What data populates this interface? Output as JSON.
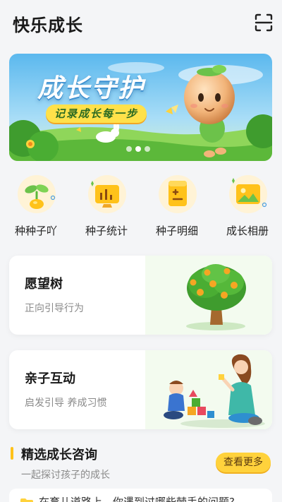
{
  "header": {
    "title": "快乐成长",
    "scan_icon": "scan-icon"
  },
  "banner": {
    "title": "成长守护",
    "subtitle": "记录成长每一步",
    "slide_count": 3,
    "active_slide": 1
  },
  "quick_actions": [
    {
      "label": "种种子吖",
      "icon": "sprout-icon"
    },
    {
      "label": "种子统计",
      "icon": "stats-icon"
    },
    {
      "label": "种子明细",
      "icon": "detail-list-icon"
    },
    {
      "label": "成长相册",
      "icon": "photo-album-icon"
    }
  ],
  "cards": {
    "wish_tree": {
      "title": "愿望树",
      "subtitle": "正向引导行为",
      "art": "orange-tree-illustration"
    },
    "parent_child": {
      "title": "亲子互动",
      "subtitle": "启发引导 养成习惯",
      "art": "mother-child-blocks-illustration"
    }
  },
  "consult": {
    "title": "精选成长咨询",
    "subtitle": "一起探讨孩子的成长",
    "more_label": "查看更多",
    "first_item": "在育儿道路上，你遇到过哪些棘手的问题?"
  },
  "colors": {
    "accent_yellow": "#ffd23c",
    "background": "#f4f5f7",
    "banner_sky": "#8fd3f5",
    "banner_grass": "#6cc24a"
  }
}
